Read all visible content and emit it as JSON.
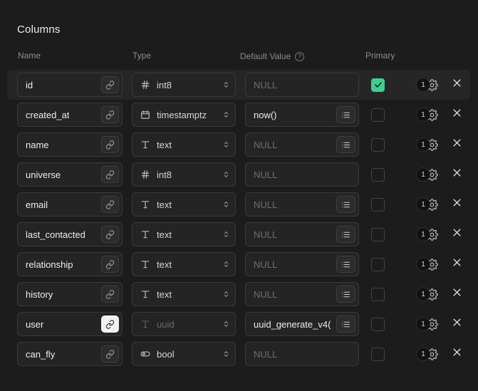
{
  "section": {
    "title": "Columns"
  },
  "headers": {
    "name": "Name",
    "type": "Type",
    "default_value": "Default Value",
    "help_glyph": "?",
    "primary": "Primary"
  },
  "row_actions": {
    "badge_count": "1",
    "gear_icon": "gear-icon",
    "close_icon": "close-icon"
  },
  "colors": {
    "accent_green": "#3ecf8e",
    "background": "#1c1c1c",
    "row_highlight": "#262626",
    "field_bg": "#242424"
  },
  "columns": [
    {
      "name": "id",
      "type": "int8",
      "type_icon": "hash-icon",
      "default": "NULL",
      "default_is_placeholder": true,
      "primary": true,
      "has_list_button": false,
      "link_active": false,
      "type_disabled": false,
      "badge": "1"
    },
    {
      "name": "created_at",
      "type": "timestamptz",
      "type_icon": "calendar-icon",
      "default": "now()",
      "default_is_placeholder": false,
      "primary": false,
      "has_list_button": true,
      "link_active": false,
      "type_disabled": false,
      "badge": "1"
    },
    {
      "name": "name",
      "type": "text",
      "type_icon": "text-icon",
      "default": "NULL",
      "default_is_placeholder": true,
      "primary": false,
      "has_list_button": true,
      "link_active": false,
      "type_disabled": false,
      "badge": "1"
    },
    {
      "name": "universe",
      "type": "int8",
      "type_icon": "hash-icon",
      "default": "NULL",
      "default_is_placeholder": true,
      "primary": false,
      "has_list_button": false,
      "link_active": false,
      "type_disabled": false,
      "badge": "1"
    },
    {
      "name": "email",
      "type": "text",
      "type_icon": "text-icon",
      "default": "NULL",
      "default_is_placeholder": true,
      "primary": false,
      "has_list_button": true,
      "link_active": false,
      "type_disabled": false,
      "badge": "1"
    },
    {
      "name": "last_contacted",
      "type": "text",
      "type_icon": "text-icon",
      "default": "NULL",
      "default_is_placeholder": true,
      "primary": false,
      "has_list_button": true,
      "link_active": false,
      "type_disabled": false,
      "badge": "1"
    },
    {
      "name": "relationship",
      "type": "text",
      "type_icon": "text-icon",
      "default": "NULL",
      "default_is_placeholder": true,
      "primary": false,
      "has_list_button": true,
      "link_active": false,
      "type_disabled": false,
      "badge": "1"
    },
    {
      "name": "history",
      "type": "text",
      "type_icon": "text-icon",
      "default": "NULL",
      "default_is_placeholder": true,
      "primary": false,
      "has_list_button": true,
      "link_active": false,
      "type_disabled": false,
      "badge": "1"
    },
    {
      "name": "user",
      "type": "uuid",
      "type_icon": "text-icon",
      "default": "uuid_generate_v4(",
      "default_is_placeholder": false,
      "primary": false,
      "has_list_button": true,
      "link_active": true,
      "type_disabled": true,
      "badge": "1"
    },
    {
      "name": "can_fly",
      "type": "bool",
      "type_icon": "toggle-icon",
      "default": "NULL",
      "default_is_placeholder": true,
      "primary": false,
      "has_list_button": false,
      "link_active": false,
      "type_disabled": false,
      "badge": "1"
    }
  ]
}
